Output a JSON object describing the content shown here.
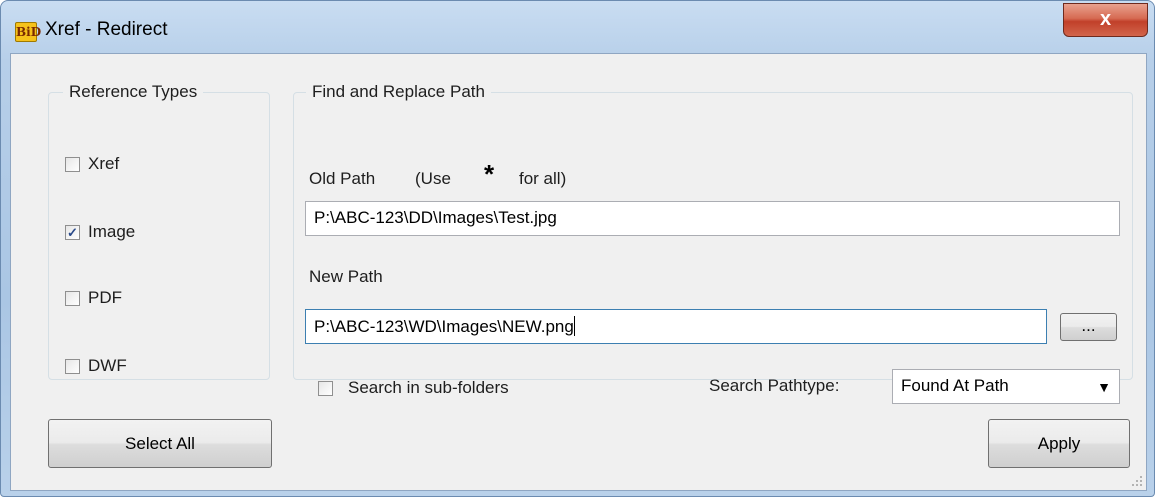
{
  "window": {
    "title": "Xref - Redirect",
    "app_icon_text": "BiD",
    "close_glyph": "x"
  },
  "reference_types": {
    "legend": "Reference Types",
    "items": [
      {
        "label": "Xref",
        "checked": false,
        "check_glyph": ""
      },
      {
        "label": "Image",
        "checked": true,
        "check_glyph": "✓"
      },
      {
        "label": "PDF",
        "checked": false,
        "check_glyph": ""
      },
      {
        "label": "DWF",
        "checked": false,
        "check_glyph": ""
      }
    ]
  },
  "find_replace": {
    "legend": "Find and Replace Path",
    "old_path_label": "Old Path",
    "old_path_hint_prefix": "(Use",
    "old_path_hint_star": "*",
    "old_path_hint_suffix": "for all)",
    "old_path_value": "P:\\ABC-123\\DD\\Images\\Test.jpg",
    "new_path_label": "New Path",
    "new_path_value": "P:\\ABC-123\\WD\\Images\\NEW.png",
    "browse_label": "...",
    "search_subfolders_label": "Search in sub-folders",
    "search_subfolders_checked": false,
    "pathtype_label": "Search Pathtype:",
    "pathtype_value": "Found At Path",
    "dropdown_glyph": "▼"
  },
  "buttons": {
    "select_all": "Select All",
    "apply": "Apply"
  },
  "icons": {
    "app": "app-logo-icon",
    "close": "close-icon",
    "dropdown": "chevron-down-icon",
    "grip": "resize-grip-icon"
  },
  "colors": {
    "titlebar": "#b7cfe9",
    "close_button": "#c1402a",
    "dialog_bg": "#f0f0f0",
    "focus_border": "#3c7fb1"
  }
}
